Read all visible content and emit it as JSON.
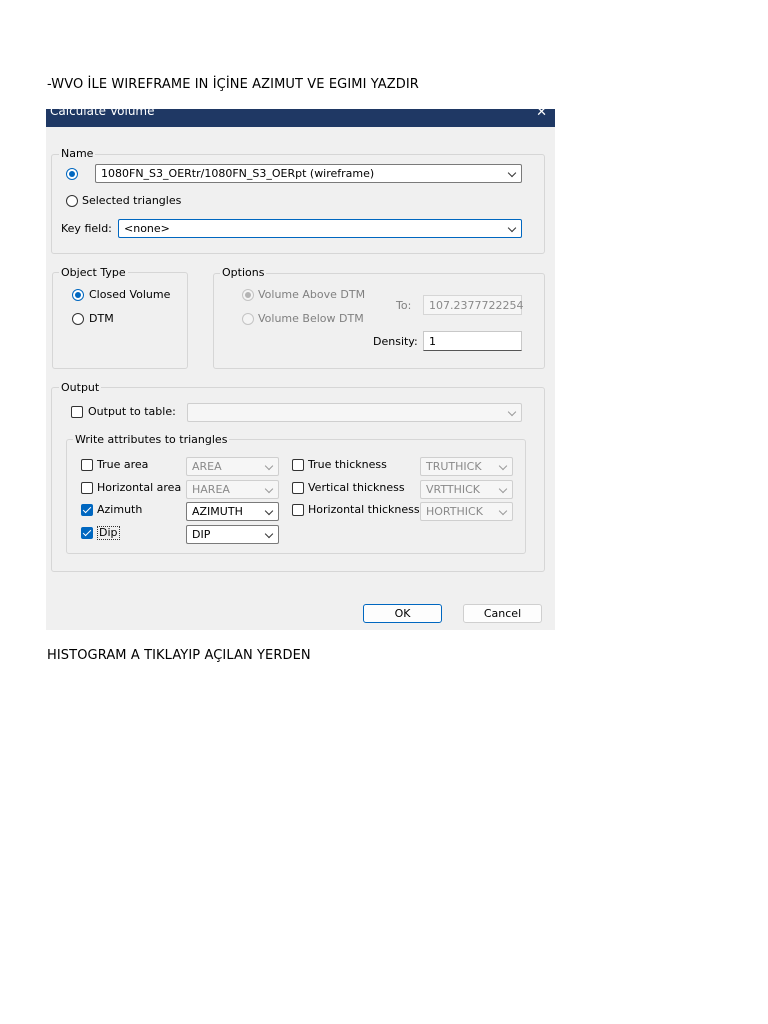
{
  "document": {
    "heading1": "-WVO İLE WIREFRAME IN İÇİNE AZIMUT VE EGIMI YAZDIR",
    "heading2": "HISTOGRAM A TIKLAYIP AÇILAN YERDEN"
  },
  "dialog": {
    "title": "Calculate Volume",
    "close_glyph": "✕",
    "name_group": {
      "label": "Name",
      "wireframe_value": "1080FN_S3_OERtr/1080FN_S3_OERpt (wireframe)",
      "selected_triangles_label": "Selected triangles",
      "key_field_label": "Key field:",
      "key_field_value": "<none>"
    },
    "object_type": {
      "label": "Object Type",
      "closed_volume": "Closed Volume",
      "dtm": "DTM"
    },
    "options": {
      "label": "Options",
      "volume_above": "Volume Above DTM",
      "volume_below": "Volume Below DTM",
      "to_label": "To:",
      "to_value": "107.2377722254",
      "density_label": "Density:",
      "density_value": "1"
    },
    "output": {
      "label": "Output",
      "output_to_table": "Output to table:",
      "write_attributes_label": "Write attributes to triangles",
      "attributes": {
        "true_area": {
          "label": "True area",
          "field": "AREA"
        },
        "horizontal_area": {
          "label": "Horizontal area",
          "field": "HAREA"
        },
        "azimuth": {
          "label": "Azimuth",
          "field": "AZIMUTH"
        },
        "dip": {
          "label": "Dip",
          "field": "DIP"
        },
        "true_thickness": {
          "label": "True thickness",
          "field": "TRUTHICK"
        },
        "vertical_thickness": {
          "label": "Vertical thickness",
          "field": "VRTTHICK"
        },
        "horizontal_thickness": {
          "label": "Horizontal thickness",
          "field": "HORTHICK"
        }
      }
    },
    "buttons": {
      "ok": "OK",
      "cancel": "Cancel"
    }
  },
  "colors": {
    "titlebar": "#1f3864",
    "accent": "#0067c0",
    "dialog_bg": "#f0f0f0"
  }
}
